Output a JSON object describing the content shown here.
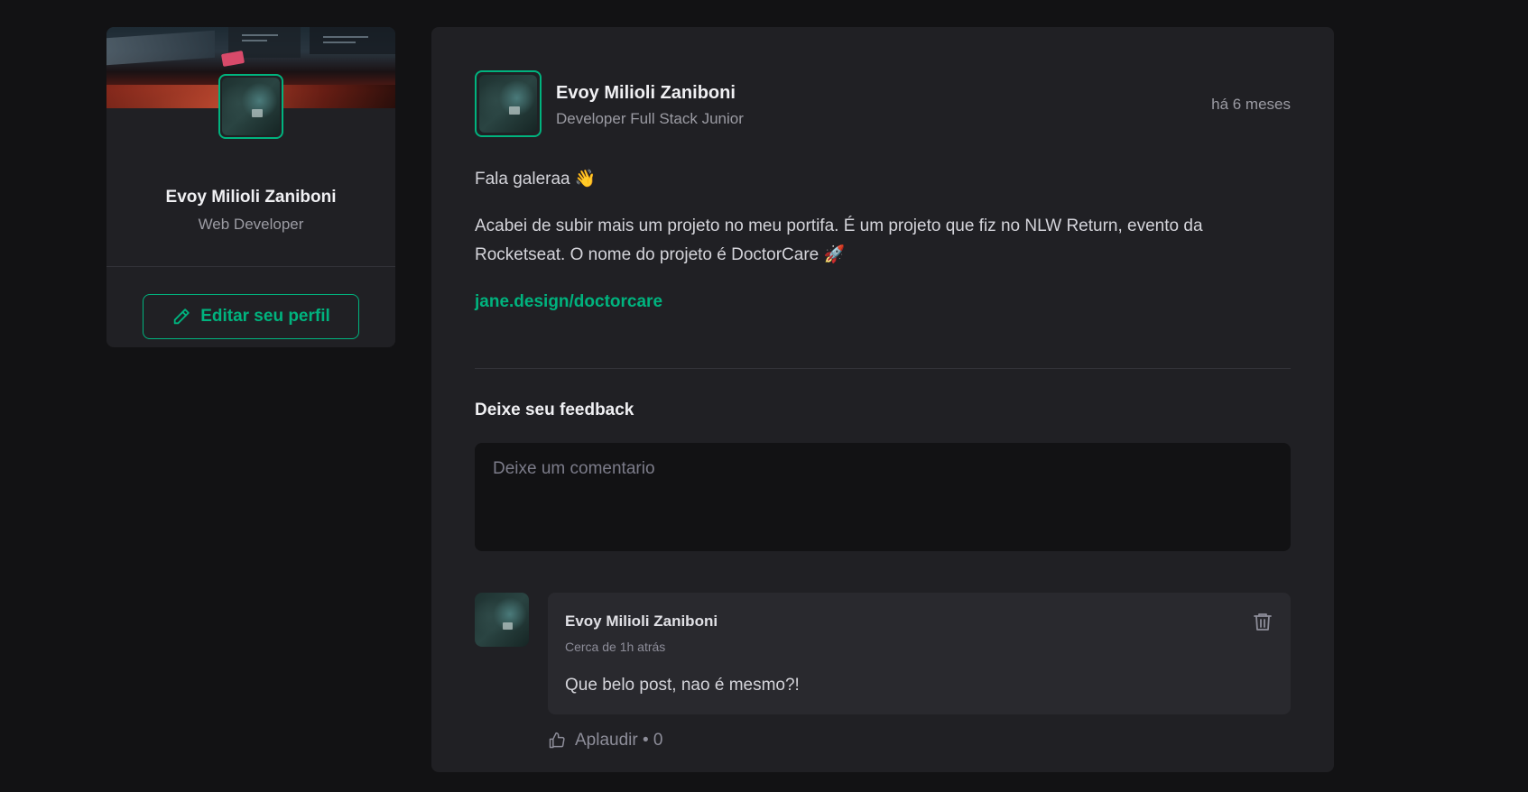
{
  "sidebar": {
    "name": "Evoy Milioli Zaniboni",
    "role": "Web Developer",
    "edit_label": "Editar seu perfil"
  },
  "post": {
    "author_name": "Evoy Milioli Zaniboni",
    "author_role": "Developer Full Stack Junior",
    "time": "há 6 meses",
    "paragraphs": [
      "Fala galeraa 👋",
      "Acabei de subir mais um projeto no meu portifa. É um projeto que fiz no NLW Return, evento da Rocketseat. O nome do projeto é DoctorCare 🚀"
    ],
    "link": "jane.design/doctorcare"
  },
  "feedback": {
    "title": "Deixe seu feedback",
    "placeholder": "Deixe um comentario"
  },
  "comment": {
    "author": "Evoy Milioli Zaniboni",
    "time": "Cerca de 1h atrás",
    "text": "Que belo post, nao é mesmo?!",
    "applaud_label": "Aplaudir • 0"
  },
  "colors": {
    "accent": "#00B37E",
    "background": "#121214",
    "card": "#202024"
  },
  "icons": {
    "edit": "pencil-icon",
    "delete": "trash-icon",
    "applaud": "thumbs-up-icon"
  }
}
